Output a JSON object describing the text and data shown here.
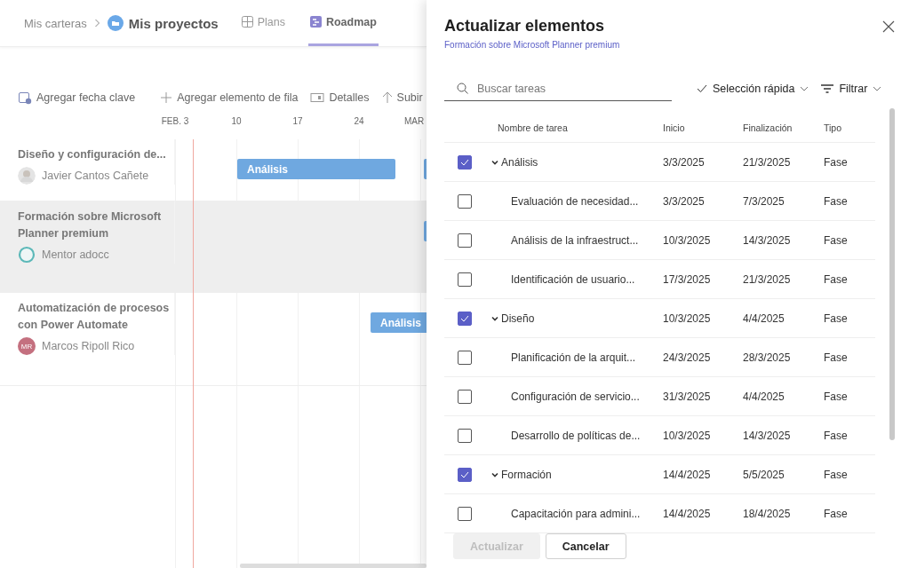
{
  "header": {
    "breadcrumb": "Mis carteras",
    "project": "Mis proyectos",
    "tabs": [
      {
        "label": "Plans",
        "selected": false
      },
      {
        "label": "Roadmap",
        "selected": true
      }
    ]
  },
  "toolbar": [
    "Agregar fecha clave",
    "Agregar elemento de fila",
    "Detalles",
    "Subir"
  ],
  "timeline": {
    "dates": [
      "FEB. 3",
      "10",
      "17",
      "24",
      "MAR"
    ],
    "rows": [
      {
        "title": "Diseño y configuración de...",
        "owner": "Javier Cantos Cañete",
        "avatar": {
          "kind": "photo"
        },
        "highlighted": false,
        "bars": [
          {
            "kind": "labeled",
            "label": "Análisis"
          },
          {
            "kind": "plain"
          }
        ]
      },
      {
        "title": "Formación sobre Microsoft Planner premium",
        "owner": "Mentor adocc",
        "avatar": {
          "kind": "ring"
        },
        "highlighted": true,
        "bars": [
          {
            "kind": "plain"
          }
        ]
      },
      {
        "title": "Automatización de procesos con Power Automate",
        "owner": "Marcos Ripoll Rico",
        "avatar": {
          "kind": "initials",
          "initials": "MR"
        },
        "highlighted": false,
        "bars": [
          {
            "kind": "labeled",
            "label": "Análisis"
          }
        ]
      }
    ]
  },
  "panel": {
    "title": "Actualizar elementos",
    "subtitle": "Formación sobre Microsoft Planner premium",
    "search": {
      "placeholder": "Buscar tareas"
    },
    "quick_select": "Selección rápida",
    "filter": "Filtrar",
    "columns": [
      "Nombre de tarea",
      "Inicio",
      "Finalización",
      "Tipo"
    ],
    "groups": [
      {
        "name": "Análisis",
        "start": "3/3/2025",
        "end": "21/3/2025",
        "type": "Fase",
        "checked": true,
        "expanded": true,
        "children": [
          {
            "name": "Evaluación de necesidad...",
            "start": "3/3/2025",
            "end": "7/3/2025",
            "type": "Fase",
            "checked": false
          },
          {
            "name": "Análisis de la infraestruct...",
            "start": "10/3/2025",
            "end": "14/3/2025",
            "type": "Fase",
            "checked": false
          },
          {
            "name": "Identificación de usuario...",
            "start": "17/3/2025",
            "end": "21/3/2025",
            "type": "Fase",
            "checked": false
          }
        ]
      },
      {
        "name": "Diseño",
        "start": "10/3/2025",
        "end": "4/4/2025",
        "type": "Fase",
        "checked": true,
        "expanded": true,
        "children": [
          {
            "name": "Planificación de la arquit...",
            "start": "24/3/2025",
            "end": "28/3/2025",
            "type": "Fase",
            "checked": false
          },
          {
            "name": "Configuración de servicio...",
            "start": "31/3/2025",
            "end": "4/4/2025",
            "type": "Fase",
            "checked": false
          },
          {
            "name": "Desarrollo de políticas de...",
            "start": "10/3/2025",
            "end": "14/3/2025",
            "type": "Fase",
            "checked": false
          }
        ]
      },
      {
        "name": "Formación",
        "start": "14/4/2025",
        "end": "5/5/2025",
        "type": "Fase",
        "checked": true,
        "expanded": true,
        "children": [
          {
            "name": "Capacitación para admini...",
            "start": "14/4/2025",
            "end": "18/4/2025",
            "type": "Fase",
            "checked": false
          }
        ]
      }
    ],
    "buttons": [
      {
        "label": "Actualizar",
        "disabled": true
      },
      {
        "label": "Cancelar",
        "disabled": false
      }
    ]
  }
}
